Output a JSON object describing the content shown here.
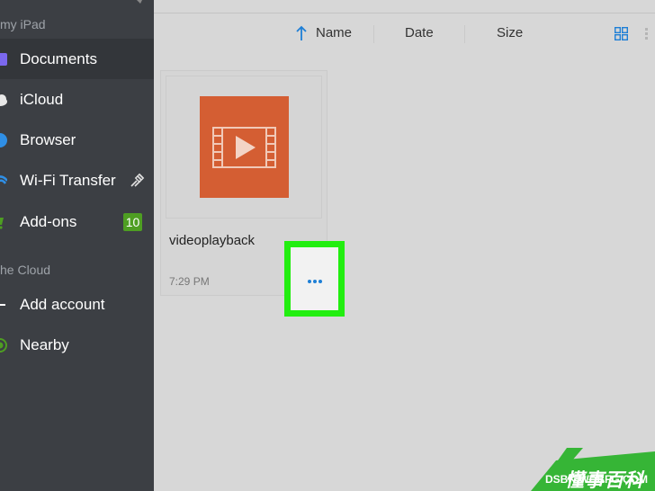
{
  "sidebar": {
    "section_device": "my iPad",
    "section_cloud": "he Cloud",
    "items": [
      {
        "label": "Documents",
        "icon": "documents-icon",
        "color": "#7b68ee"
      },
      {
        "label": "iCloud",
        "icon": "cloud-icon",
        "color": "#e8e8e8"
      },
      {
        "label": "Browser",
        "icon": "browser-icon",
        "color": "#2f8fe6"
      },
      {
        "label": "Wi-Fi Transfer",
        "icon": "wifi-icon",
        "color": "#2f8fe6"
      },
      {
        "label": "Add-ons",
        "icon": "cart-icon",
        "color": "#4e9e22",
        "badge": "10"
      },
      {
        "label": "Add account",
        "icon": "plus-icon",
        "color": "#ffffff"
      },
      {
        "label": "Nearby",
        "icon": "nearby-icon",
        "color": "#4e9e22"
      }
    ]
  },
  "sort": {
    "name": "Name",
    "date": "Date",
    "size": "Size"
  },
  "file": {
    "name": "videoplayback",
    "time": "7:29 PM",
    "thumb_color": "#d45e33"
  },
  "colors": {
    "accent": "#1e7fd6",
    "highlight": "#22ee10",
    "sidebar_bg": "#3c3f44"
  },
  "watermark": {
    "brand": "懂事百科",
    "site": "DSBK.WDBFG.COM"
  }
}
